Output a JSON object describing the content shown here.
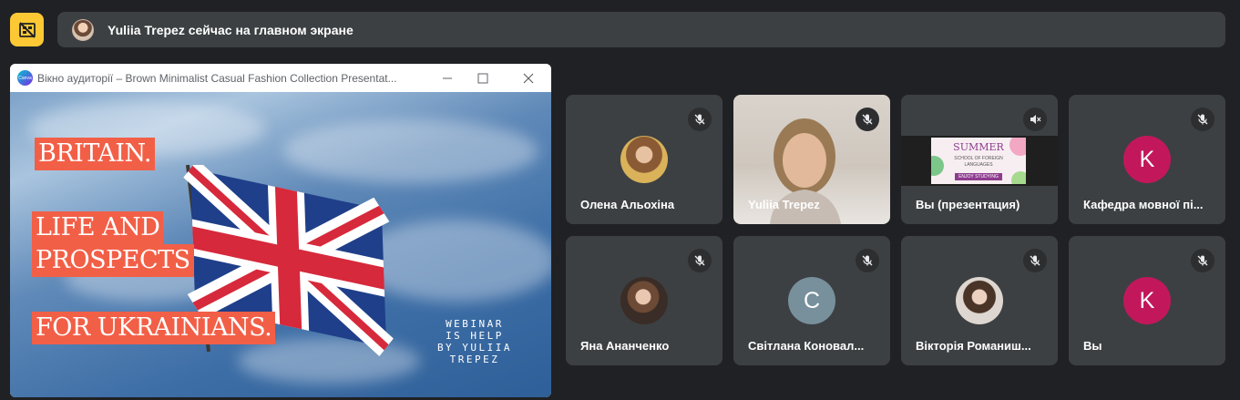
{
  "banner": {
    "presenter_text": "Yuliia Trepez сейчас на главном экране",
    "top_button_icon": "hide-tiles-icon",
    "accent": "#fcc934"
  },
  "presentation_window": {
    "title": "Вікно аудиторії – Brown Minimalist Casual Fashion Collection Presentat...",
    "logo_text": "Canva",
    "slide": {
      "line1": "BRITAIN.",
      "line2": "LIFE AND",
      "line3": "PROSPECTS",
      "line4": "FOR UKRAINIANS.",
      "webinar_line1": "WEBINAR",
      "webinar_line2": "IS HELP",
      "webinar_line3": "BY YULIIA",
      "webinar_line4": "TREPEZ"
    }
  },
  "participants": [
    {
      "name": "Олена Альохіна",
      "type": "photo",
      "mic": "muted"
    },
    {
      "name": "Yuliia Trepez",
      "type": "video",
      "mic": "muted"
    },
    {
      "name": "Вы (презентация)",
      "type": "screen",
      "mic": "audio-muted",
      "thumb_title": "SUMMER",
      "thumb_sub1": "SCHOOL OF FOREIGN",
      "thumb_sub2": "LANGUAGES",
      "thumb_tag": "ENJOY STUDYING"
    },
    {
      "name": "Кафедра мовної пі...",
      "type": "letter",
      "letter": "K",
      "color": "#c2185b",
      "mic": "muted"
    },
    {
      "name": "Яна Ананченко",
      "type": "photo",
      "mic": "muted"
    },
    {
      "name": "Світлана Коновал...",
      "type": "letter",
      "letter": "C",
      "color": "#78909c",
      "mic": "muted"
    },
    {
      "name": "Вікторія Романиш...",
      "type": "photo",
      "mic": "muted"
    },
    {
      "name": "Вы",
      "type": "letter",
      "letter": "K",
      "color": "#c2185b",
      "mic": "muted"
    }
  ]
}
